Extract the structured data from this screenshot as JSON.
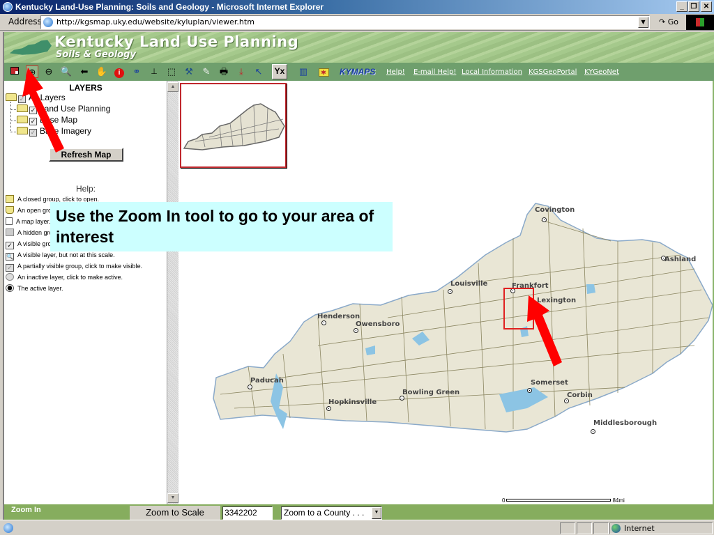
{
  "window": {
    "title": "Kentucky Land-Use Planning: Soils and Geology - Microsoft Internet Explorer",
    "controls": [
      "minimize",
      "restore",
      "close"
    ]
  },
  "address_bar": {
    "label": "Address",
    "url": "http://kgsmap.uky.edu/website/kyluplan/viewer.htm",
    "go_label": "Go"
  },
  "banner": {
    "title": "Kentucky Land Use Planning",
    "subtitle": "Soils & Geology"
  },
  "toolbar": {
    "tools": [
      {
        "name": "toggle-legend",
        "glyph": "◧"
      },
      {
        "name": "zoom-in",
        "glyph": "⊕",
        "active": true
      },
      {
        "name": "zoom-out",
        "glyph": "⊖"
      },
      {
        "name": "zoom-full-extent",
        "glyph": "🔍"
      },
      {
        "name": "back",
        "glyph": "⬅"
      },
      {
        "name": "pan",
        "glyph": "✋"
      },
      {
        "name": "identify",
        "glyph": "ℹ"
      },
      {
        "name": "find",
        "glyph": "🔭"
      },
      {
        "name": "measure",
        "glyph": "📏"
      },
      {
        "name": "select-rectangle",
        "glyph": "⬚"
      },
      {
        "name": "query",
        "glyph": "⚒"
      },
      {
        "name": "clear-selection",
        "glyph": "✎"
      },
      {
        "name": "print",
        "glyph": "🖶"
      },
      {
        "name": "download",
        "glyph": "📥"
      },
      {
        "name": "select-point",
        "glyph": "↖"
      },
      {
        "name": "xy-coordinates",
        "glyph": "Y·X"
      },
      {
        "name": "bookmark",
        "glyph": "▥"
      },
      {
        "name": "open-folder",
        "glyph": "✱"
      }
    ],
    "kymaps_label": "KYMAPS",
    "links": [
      "Help!",
      "E-mail Help!",
      "Local Information",
      "KGSGeoPortal",
      "KYGeoNet"
    ]
  },
  "layers_panel": {
    "title": "LAYERS",
    "tree": [
      {
        "label": "All Layers",
        "check": "partial",
        "level": 0
      },
      {
        "label": "Land Use Planning",
        "check": "checked",
        "level": 1
      },
      {
        "label": "Base Map",
        "check": "checked",
        "level": 1
      },
      {
        "label": "Base Imagery",
        "check": "partial",
        "level": 1
      }
    ],
    "refresh_label": "Refresh Map",
    "help_title": "Help:",
    "help_items": [
      {
        "icon": "closed-folder",
        "text": "A closed group, click to open."
      },
      {
        "icon": "open-folder",
        "text": "An open group, click to close."
      },
      {
        "icon": "map-layer",
        "text": "A map layer."
      },
      {
        "icon": "hidden-box",
        "text": "A hidden group or layer, click to make visible."
      },
      {
        "icon": "checked-box",
        "text": "A visible group or layer, click to hide."
      },
      {
        "icon": "magnifier-box",
        "text": "A visible layer, but not at this scale."
      },
      {
        "icon": "partial-box",
        "text": "A partially visible group, click to make visible."
      },
      {
        "icon": "radio-empty",
        "text": "An inactive layer, click to make active."
      },
      {
        "icon": "radio-filled",
        "text": "The active layer."
      }
    ]
  },
  "map": {
    "cities": [
      {
        "name": "Covington"
      },
      {
        "name": "Ashland"
      },
      {
        "name": "Louisville"
      },
      {
        "name": "Frankfort"
      },
      {
        "name": "Lexington"
      },
      {
        "name": "Henderson"
      },
      {
        "name": "Owensboro"
      },
      {
        "name": "Paducah"
      },
      {
        "name": "Hopkinsville"
      },
      {
        "name": "Bowling Green"
      },
      {
        "name": "Somerset"
      },
      {
        "name": "Corbin"
      },
      {
        "name": "Middlesborough"
      }
    ],
    "scalebar": {
      "start": "0",
      "end": "84mi"
    }
  },
  "bottom_bar": {
    "mode_label": "Zoom In",
    "zoom_scale_label": "Zoom to Scale",
    "scale_value": "3342202",
    "county_select": "Zoom to a County . . ."
  },
  "ie_status": {
    "zone": "Internet"
  },
  "annotation": {
    "callout_text": "Use the Zoom In tool to go to your area of interest",
    "accent_color": "#ff0000",
    "callout_bg": "#ccffff"
  }
}
